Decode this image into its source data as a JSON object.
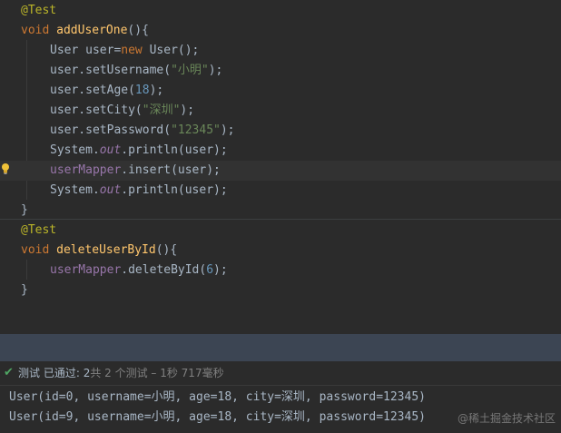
{
  "editor": {
    "method1": {
      "annotation": "@Test",
      "kw_void": "void",
      "name": "addUserOne",
      "open": "(){",
      "l1_type": "User",
      "l1_var": " user=",
      "l1_new": "new",
      "l1_rest": " User();",
      "l2_call": "user.setUsername(",
      "l2_str": "\"小明\"",
      "l2_end": ");",
      "l3_call": "user.setAge(",
      "l3_num": "18",
      "l3_end": ");",
      "l4_call": "user.setCity(",
      "l4_str": "\"深圳\"",
      "l4_end": ");",
      "l5_call": "user.setPassword(",
      "l5_str": "\"12345\"",
      "l5_end": ");",
      "l6_cls": "System.",
      "l6_out": "out",
      "l6_rest": ".println(user);",
      "l7_obj": "userMapper",
      "l7_rest": ".insert(user);",
      "l8_cls": "System.",
      "l8_out": "out",
      "l8_rest": ".println(user);",
      "close": "}"
    },
    "method2": {
      "annotation": "@Test",
      "kw_void": "void",
      "name": "deleteUserById",
      "open": "(){",
      "l1_obj": "userMapper",
      "l1_call": ".deleteById(",
      "l1_num": "6",
      "l1_end": ");",
      "close": "}"
    }
  },
  "run_status": {
    "passed_label": "测试 已通过:",
    "passed_count": "2",
    "summary": "共 2 个测试 – 1秒 717毫秒"
  },
  "console": {
    "lines": [
      "User(id=0, username=小明, age=18, city=深圳, password=12345)",
      "User(id=9, username=小明, age=18, city=深圳, password=12345)"
    ]
  },
  "watermark": "@稀土掘金技术社区",
  "colors": {
    "background": "#2b2b2b",
    "annotation": "#bbb529",
    "keyword": "#cc7832",
    "function": "#ffc66d",
    "string": "#6a8759",
    "number": "#6897bb",
    "field": "#9876aa",
    "pass": "#4fa663"
  }
}
